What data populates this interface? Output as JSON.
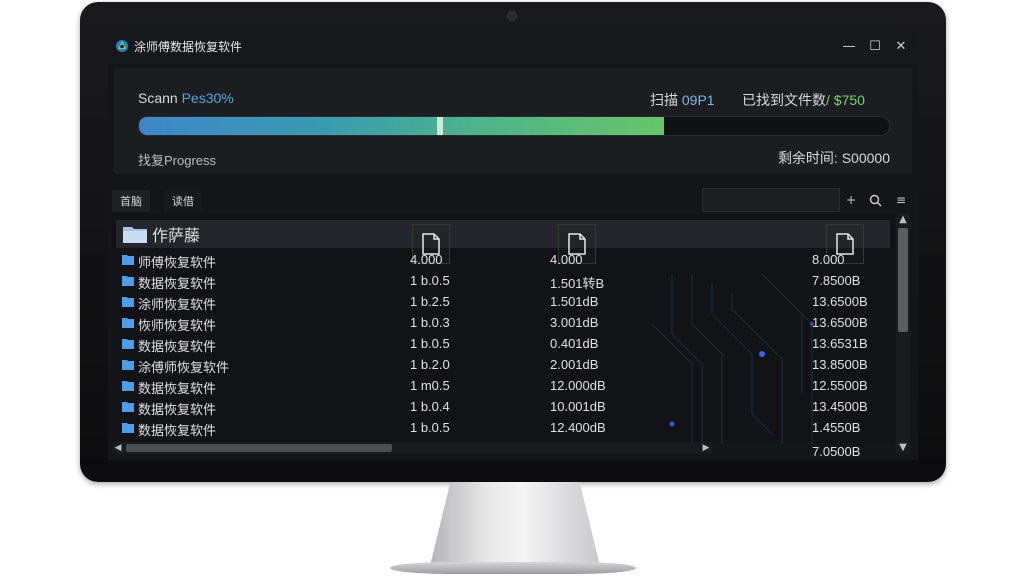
{
  "window": {
    "title": "涂师傅数据恢复软件",
    "controls": {
      "minimize": "—",
      "maximize": "☐",
      "close": "✕"
    }
  },
  "scan": {
    "label_prefix": "Scann ",
    "label_pct": "Pes30%",
    "count_prefix": "扫描 ",
    "count_value": "09Ρ1",
    "found_prefix": "已找到文件数",
    "found_value": "/ $750",
    "progress_fraction": 0.7,
    "progress_label": "找复Progress",
    "remaining": "剩余时间: S00000",
    "colors": {
      "accent_blue": "#4fa8d8",
      "accent_green": "#7cd36b"
    }
  },
  "tabs": [
    {
      "label": "首脑"
    },
    {
      "label": "读借"
    }
  ],
  "toolbar": {
    "add": "+",
    "search": "⌕",
    "menu": "≡"
  },
  "list": {
    "header_title": "作萨藤",
    "column_icons": [
      "file-icon",
      "file-icon",
      "file-icon"
    ],
    "rows": [
      {
        "name": "师傅恢复软件",
        "c1": "4.000",
        "c2": "4.000",
        "c3": "8.000"
      },
      {
        "name": "数据恢复软件",
        "c1": "1 b.0.5",
        "c2": "1.501转B",
        "c3": "7.8500B"
      },
      {
        "name": "涂师恢复软件",
        "c1": "1 b.2.5",
        "c2": "1.501dB",
        "c3": "13.6500B"
      },
      {
        "name": "恢师恢复软件",
        "c1": "1 b.0.3",
        "c2": "3.001dB",
        "c3": "13.6500B"
      },
      {
        "name": "数据恢复软件",
        "c1": "1 b.0.5",
        "c2": "0.401dB",
        "c3": "13.6531B"
      },
      {
        "name": "涂傅师恢复软件",
        "c1": "1 b.2.0",
        "c2": "2.001dB",
        "c3": "13.8500B"
      },
      {
        "name": "数据恢复软件",
        "c1": "1 m0.5",
        "c2": "12.000dB",
        "c3": "12.5500B"
      },
      {
        "name": "数据恢复软件",
        "c1": "1 b.0.4",
        "c2": "10.001dB",
        "c3": "13.4500B"
      },
      {
        "name": "数据恢复软件",
        "c1": "1 b.0.5",
        "c2": "12.400dB",
        "c3": "1.4550B"
      }
    ],
    "overflow_value": "7.0500B"
  }
}
